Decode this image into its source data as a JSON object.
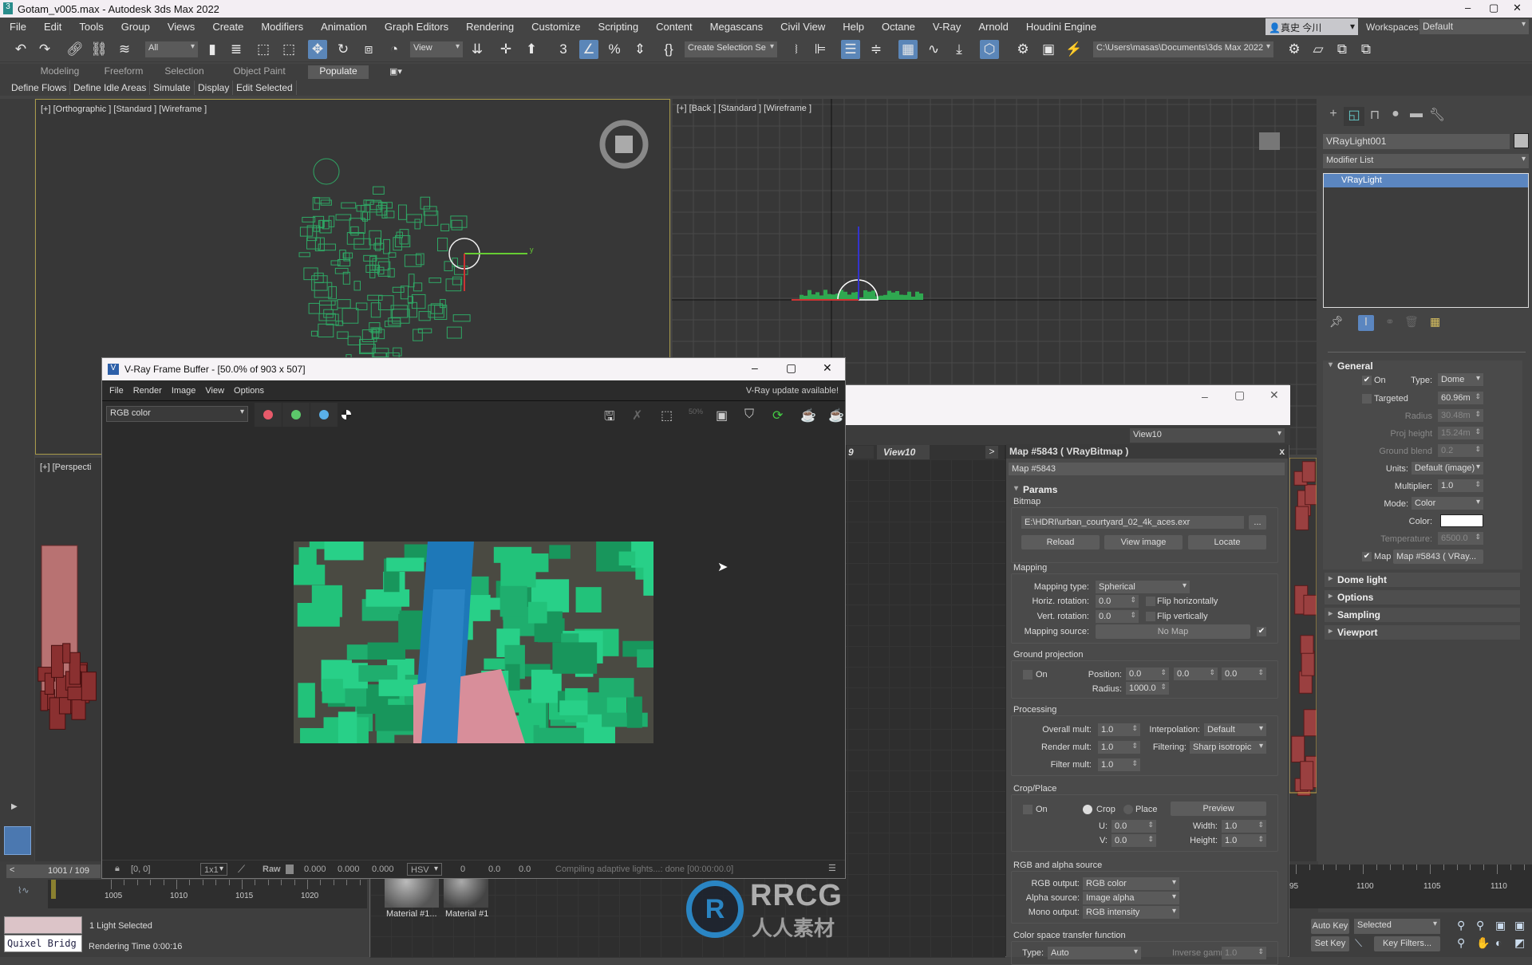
{
  "app": {
    "title": "Gotam_v005.max - Autodesk 3ds Max 2022",
    "min": "–",
    "max": "▢",
    "close": "✕"
  },
  "menu": [
    "File",
    "Edit",
    "Tools",
    "Group",
    "Views",
    "Create",
    "Modifiers",
    "Animation",
    "Graph Editors",
    "Rendering",
    "Customize",
    "Scripting",
    "Content",
    "Megascans",
    "Civil View",
    "Help",
    "Octane",
    "V-Ray",
    "Arnold",
    "Houdini Engine"
  ],
  "user": {
    "name": "真史 今川",
    "workspaces_label": "Workspaces:",
    "workspace": "Default"
  },
  "toolbar": {
    "filter": "All",
    "ref_coord": "View",
    "named_sel": "Create Selection Se",
    "project_path": "C:\\Users\\masas\\Documents\\3ds Max 2022"
  },
  "ribbon": {
    "tabs": [
      "Modeling",
      "Freeform",
      "Selection",
      "Object Paint",
      "Populate"
    ],
    "active": "Populate",
    "sub": [
      "Define Flows",
      "Define Idle Areas",
      "Simulate",
      "Display",
      "Edit Selected"
    ]
  },
  "viewports": {
    "ortho": "[+] [Orthographic ] [Standard ] [Wireframe ]",
    "back": "[+] [Back ] [Standard ] [Wireframe ]",
    "persp": "[+] [Perspecti"
  },
  "vfb": {
    "title": "V-Ray Frame Buffer - [50.0% of 903 x 507]",
    "menu": [
      "File",
      "Render",
      "Image",
      "View",
      "Options"
    ],
    "update": "V-Ray update available!",
    "channel": "RGB color",
    "channel_colors": [
      "#e85a6a",
      "#5cc86a",
      "#5ab0e8"
    ],
    "bottom": {
      "coords": "[0, 0]",
      "sample": "1x1",
      "raw": "Raw",
      "r": "0.000",
      "g": "0.000",
      "b": "0.000",
      "mode": "HSV",
      "h": "0",
      "s": "0.0",
      "v": "0.0",
      "status": "Compiling adaptive lights...: done [00:00:00.0]"
    }
  },
  "slate": {
    "view": "View10",
    "tab_prev": "9",
    "tab": "View10",
    "tab_more": ">",
    "materials": [
      "Material #1...",
      "Material #1"
    ]
  },
  "map": {
    "header": "Map #5843  ( VRayBitmap )",
    "close": "x",
    "name": "Map #5843",
    "params": "Params",
    "bitmap": {
      "label": "Bitmap",
      "path": "E:\\HDRI\\urban_courtyard_02_4k_aces.exr",
      "browse": "...",
      "reload": "Reload",
      "view": "View image",
      "locate": "Locate"
    },
    "mapping": {
      "label": "Mapping",
      "type_label": "Mapping type:",
      "type": "Spherical",
      "horiz_label": "Horiz. rotation:",
      "horiz": "0.0",
      "flip_h": "Flip horizontally",
      "vert_label": "Vert. rotation:",
      "vert": "0.0",
      "flip_v": "Flip vertically",
      "source_label": "Mapping source:",
      "source": "No Map"
    },
    "ground": {
      "label": "Ground projection",
      "on": "On",
      "pos_label": "Position:",
      "pos": [
        "0.0",
        "0.0",
        "0.0"
      ],
      "radius_label": "Radius:",
      "radius": "1000.0"
    },
    "processing": {
      "label": "Processing",
      "overall_label": "Overall mult:",
      "overall": "1.0",
      "interp_label": "Interpolation:",
      "interp": "Default",
      "render_label": "Render mult:",
      "render": "1.0",
      "filter_label": "Filtering:",
      "filter": "Sharp isotropic",
      "fmult_label": "Filter mult:",
      "fmult": "1.0"
    },
    "crop": {
      "label": "Crop/Place",
      "on": "On",
      "crop": "Crop",
      "place": "Place",
      "preview": "Preview",
      "u_label": "U:",
      "u": "0.0",
      "v_label": "V:",
      "v": "0.0",
      "w_label": "Width:",
      "w": "1.0",
      "h_label": "Height:",
      "h": "1.0"
    },
    "rgb": {
      "label": "RGB and alpha source",
      "rgb_label": "RGB output:",
      "rgb": "RGB color",
      "alpha_label": "Alpha source:",
      "alpha": "Image alpha",
      "mono_label": "Mono output:",
      "mono": "RGB intensity"
    },
    "cs": {
      "label": "Color space transfer function",
      "type_label": "Type:",
      "type": "Auto",
      "gamma_label": "Inverse gamma:",
      "gamma": "1.0"
    }
  },
  "cmd": {
    "object": "VRayLight001",
    "modlist": "Modifier List",
    "stack": [
      "VRayLight"
    ],
    "general": {
      "title": "General",
      "on": "On",
      "type_label": "Type:",
      "type": "Dome",
      "targeted": "Targeted",
      "targeted_val": "60.96m",
      "radius_label": "Radius",
      "radius": "30.48m",
      "proj_label": "Proj height",
      "proj": "15.24m",
      "blend_label": "Ground blend",
      "blend": "0.2",
      "units_label": "Units:",
      "units": "Default (image)",
      "mult_label": "Multiplier:",
      "mult": "1.0",
      "mode_label": "Mode:",
      "mode": "Color",
      "color_label": "Color:",
      "color": "#ffffff",
      "temp_label": "Temperature:",
      "temp": "6500.0",
      "map_label": "Map",
      "map": "Map #5843 ( VRay..."
    },
    "rollouts": [
      "Dome light",
      "Options",
      "Sampling",
      "Viewport"
    ]
  },
  "timeline": {
    "frame": "1001 / 109",
    "ticks_left": [
      "1005",
      "1010",
      "1015",
      "1020"
    ],
    "ticks_right": [
      "95",
      "1100",
      "1105",
      "1110"
    ]
  },
  "status": {
    "script": "Quixel Bridg",
    "selected": "1 Light Selected",
    "render_time": "Rendering Time  0:00:16"
  },
  "anim": {
    "autokey": "Auto Key",
    "setkey": "Set Key",
    "sel": "Selected",
    "filters": "Key Filters..."
  },
  "watermark": {
    "text": "RRCG",
    "sub": "人人素材"
  }
}
